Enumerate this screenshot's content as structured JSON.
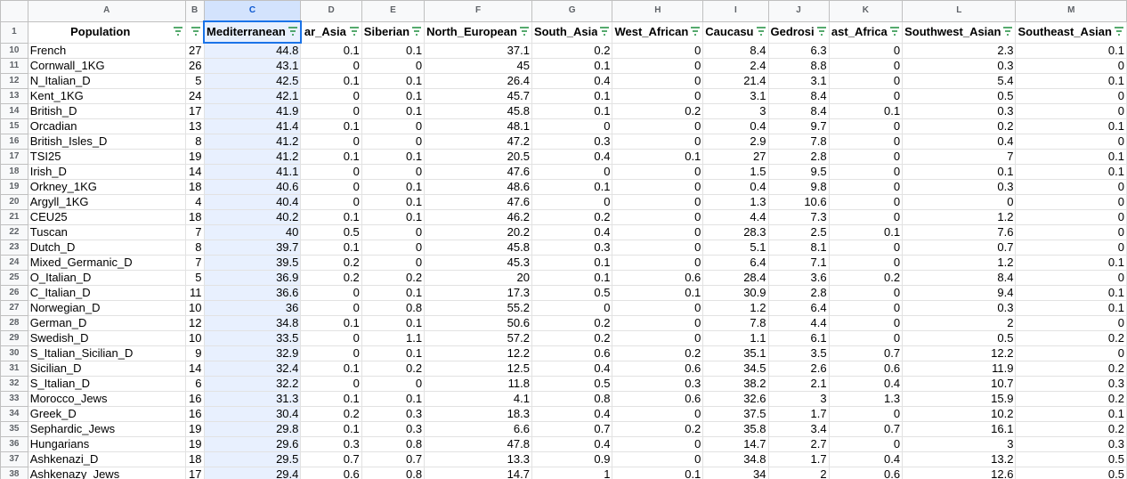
{
  "sheet": {
    "column_letters": [
      "A",
      "B",
      "C",
      "D",
      "E",
      "F",
      "G",
      "H",
      "I",
      "J",
      "K",
      "L",
      "M"
    ],
    "selected_column": "C",
    "header_row_number": "1",
    "headers": [
      "Population",
      "",
      "Mediterranean",
      "ar_Asia",
      "Siberian",
      "North_European",
      "South_Asia",
      "West_African",
      "Caucasu",
      "Gedrosi",
      "ast_Africa",
      "Southwest_Asian",
      "Southeast_Asian"
    ],
    "rows": [
      {
        "n": "10",
        "cells": [
          "French",
          "27",
          "44.8",
          "0.1",
          "0.1",
          "37.1",
          "0.2",
          "0",
          "8.4",
          "6.3",
          "0",
          "2.3",
          "0.1"
        ]
      },
      {
        "n": "11",
        "cells": [
          "Cornwall_1KG",
          "26",
          "43.1",
          "0",
          "0",
          "45",
          "0.1",
          "0",
          "2.4",
          "8.8",
          "0",
          "0.3",
          "0"
        ]
      },
      {
        "n": "12",
        "cells": [
          "N_Italian_D",
          "5",
          "42.5",
          "0.1",
          "0.1",
          "26.4",
          "0.4",
          "0",
          "21.4",
          "3.1",
          "0",
          "5.4",
          "0.1"
        ]
      },
      {
        "n": "13",
        "cells": [
          "Kent_1KG",
          "24",
          "42.1",
          "0",
          "0.1",
          "45.7",
          "0.1",
          "0",
          "3.1",
          "8.4",
          "0",
          "0.5",
          "0"
        ]
      },
      {
        "n": "14",
        "cells": [
          "British_D",
          "17",
          "41.9",
          "0",
          "0.1",
          "45.8",
          "0.1",
          "0.2",
          "3",
          "8.4",
          "0.1",
          "0.3",
          "0"
        ]
      },
      {
        "n": "15",
        "cells": [
          "Orcadian",
          "13",
          "41.4",
          "0.1",
          "0",
          "48.1",
          "0",
          "0",
          "0.4",
          "9.7",
          "0",
          "0.2",
          "0.1"
        ]
      },
      {
        "n": "16",
        "cells": [
          "British_Isles_D",
          "8",
          "41.2",
          "0",
          "0",
          "47.2",
          "0.3",
          "0",
          "2.9",
          "7.8",
          "0",
          "0.4",
          "0"
        ]
      },
      {
        "n": "17",
        "cells": [
          "TSI25",
          "19",
          "41.2",
          "0.1",
          "0.1",
          "20.5",
          "0.4",
          "0.1",
          "27",
          "2.8",
          "0",
          "7",
          "0.1"
        ]
      },
      {
        "n": "18",
        "cells": [
          "Irish_D",
          "14",
          "41.1",
          "0",
          "0",
          "47.6",
          "0",
          "0",
          "1.5",
          "9.5",
          "0",
          "0.1",
          "0.1"
        ]
      },
      {
        "n": "19",
        "cells": [
          "Orkney_1KG",
          "18",
          "40.6",
          "0",
          "0.1",
          "48.6",
          "0.1",
          "0",
          "0.4",
          "9.8",
          "0",
          "0.3",
          "0"
        ]
      },
      {
        "n": "20",
        "cells": [
          "Argyll_1KG",
          "4",
          "40.4",
          "0",
          "0.1",
          "47.6",
          "0",
          "0",
          "1.3",
          "10.6",
          "0",
          "0",
          "0"
        ]
      },
      {
        "n": "21",
        "cells": [
          "CEU25",
          "18",
          "40.2",
          "0.1",
          "0.1",
          "46.2",
          "0.2",
          "0",
          "4.4",
          "7.3",
          "0",
          "1.2",
          "0"
        ]
      },
      {
        "n": "22",
        "cells": [
          "Tuscan",
          "7",
          "40",
          "0.5",
          "0",
          "20.2",
          "0.4",
          "0",
          "28.3",
          "2.5",
          "0.1",
          "7.6",
          "0"
        ]
      },
      {
        "n": "23",
        "cells": [
          "Dutch_D",
          "8",
          "39.7",
          "0.1",
          "0",
          "45.8",
          "0.3",
          "0",
          "5.1",
          "8.1",
          "0",
          "0.7",
          "0"
        ]
      },
      {
        "n": "24",
        "cells": [
          "Mixed_Germanic_D",
          "7",
          "39.5",
          "0.2",
          "0",
          "45.3",
          "0.1",
          "0",
          "6.4",
          "7.1",
          "0",
          "1.2",
          "0.1"
        ]
      },
      {
        "n": "25",
        "cells": [
          "O_Italian_D",
          "5",
          "36.9",
          "0.2",
          "0.2",
          "20",
          "0.1",
          "0.6",
          "28.4",
          "3.6",
          "0.2",
          "8.4",
          "0"
        ]
      },
      {
        "n": "26",
        "cells": [
          "C_Italian_D",
          "11",
          "36.6",
          "0",
          "0.1",
          "17.3",
          "0.5",
          "0.1",
          "30.9",
          "2.8",
          "0",
          "9.4",
          "0.1"
        ]
      },
      {
        "n": "27",
        "cells": [
          "Norwegian_D",
          "10",
          "36",
          "0",
          "0.8",
          "55.2",
          "0",
          "0",
          "1.2",
          "6.4",
          "0",
          "0.3",
          "0.1"
        ]
      },
      {
        "n": "28",
        "cells": [
          "German_D",
          "12",
          "34.8",
          "0.1",
          "0.1",
          "50.6",
          "0.2",
          "0",
          "7.8",
          "4.4",
          "0",
          "2",
          "0"
        ]
      },
      {
        "n": "29",
        "cells": [
          "Swedish_D",
          "10",
          "33.5",
          "0",
          "1.1",
          "57.2",
          "0.2",
          "0",
          "1.1",
          "6.1",
          "0",
          "0.5",
          "0.2"
        ]
      },
      {
        "n": "30",
        "cells": [
          "S_Italian_Sicilian_D",
          "9",
          "32.9",
          "0",
          "0.1",
          "12.2",
          "0.6",
          "0.2",
          "35.1",
          "3.5",
          "0.7",
          "12.2",
          "0"
        ]
      },
      {
        "n": "31",
        "cells": [
          "Sicilian_D",
          "14",
          "32.4",
          "0.1",
          "0.2",
          "12.5",
          "0.4",
          "0.6",
          "34.5",
          "2.6",
          "0.6",
          "11.9",
          "0.2"
        ]
      },
      {
        "n": "32",
        "cells": [
          "S_Italian_D",
          "6",
          "32.2",
          "0",
          "0",
          "11.8",
          "0.5",
          "0.3",
          "38.2",
          "2.1",
          "0.4",
          "10.7",
          "0.3"
        ]
      },
      {
        "n": "33",
        "cells": [
          "Morocco_Jews",
          "16",
          "31.3",
          "0.1",
          "0.1",
          "4.1",
          "0.8",
          "0.6",
          "32.6",
          "3",
          "1.3",
          "15.9",
          "0.2"
        ]
      },
      {
        "n": "34",
        "cells": [
          "Greek_D",
          "16",
          "30.4",
          "0.2",
          "0.3",
          "18.3",
          "0.4",
          "0",
          "37.5",
          "1.7",
          "0",
          "10.2",
          "0.1"
        ]
      },
      {
        "n": "35",
        "cells": [
          "Sephardic_Jews",
          "19",
          "29.8",
          "0.1",
          "0.3",
          "6.6",
          "0.7",
          "0.2",
          "35.8",
          "3.4",
          "0.7",
          "16.1",
          "0.2"
        ]
      },
      {
        "n": "36",
        "cells": [
          "Hungarians",
          "19",
          "29.6",
          "0.3",
          "0.8",
          "47.8",
          "0.4",
          "0",
          "14.7",
          "2.7",
          "0",
          "3",
          "0.3"
        ]
      },
      {
        "n": "37",
        "cells": [
          "Ashkenazi_D",
          "18",
          "29.5",
          "0.7",
          "0.7",
          "13.3",
          "0.9",
          "0",
          "34.8",
          "1.7",
          "0.4",
          "13.2",
          "0.5"
        ]
      },
      {
        "n": "38",
        "cells": [
          "Ashkenazy_Jews",
          "17",
          "29.4",
          "0.6",
          "0.8",
          "14.7",
          "1",
          "0.1",
          "34",
          "2",
          "0.6",
          "12.6",
          "0.5"
        ]
      }
    ]
  }
}
